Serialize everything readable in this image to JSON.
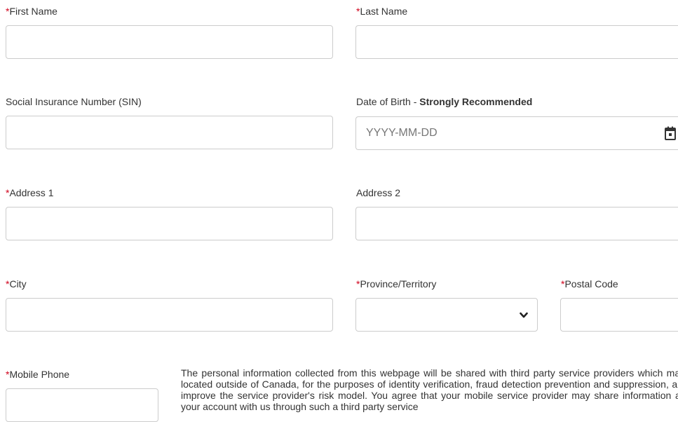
{
  "form": {
    "required_marker": "*",
    "first_name": {
      "label": "First Name",
      "required": true,
      "value": ""
    },
    "last_name": {
      "label": "Last Name",
      "required": true,
      "value": ""
    },
    "sin": {
      "label": "Social Insurance Number (SIN)",
      "required": false,
      "value": ""
    },
    "dob": {
      "label": "Date of Birth - ",
      "label_emphasis": "Strongly Recommended",
      "required": false,
      "placeholder": "YYYY-MM-DD",
      "icon": "calendar-icon"
    },
    "address1": {
      "label": "Address 1",
      "required": true,
      "value": ""
    },
    "address2": {
      "label": "Address 2",
      "required": false,
      "value": ""
    },
    "city": {
      "label": "City",
      "required": true,
      "value": ""
    },
    "province": {
      "label": "Province/Territory",
      "required": true,
      "selected": "",
      "icon": "chevron-down-icon"
    },
    "postal_code": {
      "label": "Postal Code",
      "required": true,
      "value": ""
    },
    "mobile_phone": {
      "label": "Mobile Phone",
      "required": true,
      "value": ""
    }
  },
  "notice": {
    "text": "The personal information collected from this webpage will be shared with third party service providers which may be located outside of Canada, for the purposes of identity verification, fraud detection prevention and suppression, and to improve the service provider's risk model. You agree that your mobile service provider may share information about your account with us through such a third party service"
  },
  "colors": {
    "required_marker": "#d0021b",
    "text": "#333333",
    "border": "#cccccc",
    "placeholder": "#777777"
  }
}
